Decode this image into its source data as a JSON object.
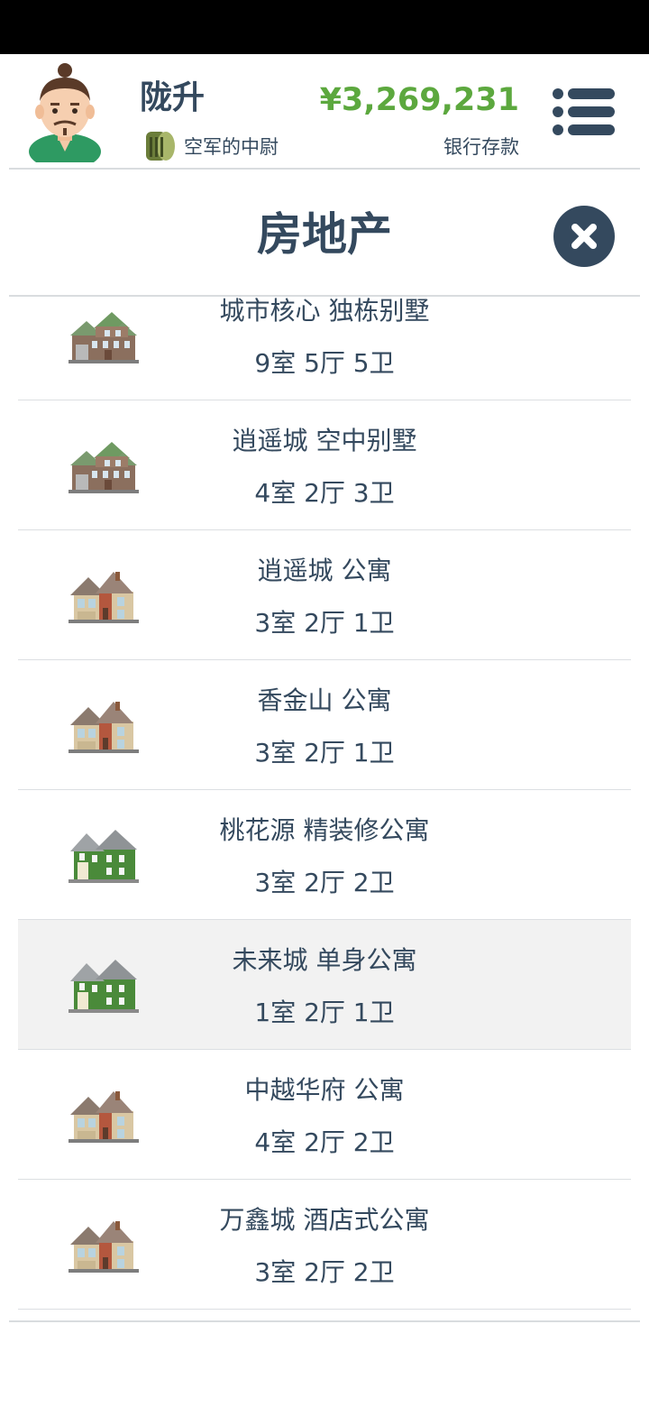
{
  "header": {
    "player_name": "陇升",
    "rank": "空军的中尉",
    "money": "¥3,269,231",
    "money_label": "银行存款",
    "menu_icon": "hamburger-menu-icon",
    "rank_icon": "rank-badge-icon",
    "avatar_icon": "avatar-man-icon"
  },
  "page": {
    "title": "房地产",
    "close_icon": "close-icon"
  },
  "colors": {
    "text": "#34495e",
    "money": "#5ca83e",
    "highlight_row": "#f2f2f2"
  },
  "properties": [
    {
      "name": "城市核心 独栋别墅",
      "rooms": "9室 5厅 5卫",
      "icon": "villa-icon"
    },
    {
      "name": "逍遥城 空中别墅",
      "rooms": "4室 2厅 3卫",
      "icon": "villa-icon"
    },
    {
      "name": "逍遥城 公寓",
      "rooms": "3室 2厅 1卫",
      "icon": "brown-house-icon"
    },
    {
      "name": "香金山 公寓",
      "rooms": "3室 2厅 1卫",
      "icon": "brown-house-icon"
    },
    {
      "name": "桃花源 精装修公寓",
      "rooms": "3室 2厅 2卫",
      "icon": "green-house-icon"
    },
    {
      "name": "未来城 单身公寓",
      "rooms": "1室 2厅 1卫",
      "icon": "green-house-icon",
      "highlighted": true
    },
    {
      "name": "中越华府 公寓",
      "rooms": "4室 2厅 2卫",
      "icon": "brown-house-icon"
    },
    {
      "name": "万鑫城 酒店式公寓",
      "rooms": "3室 2厅 2卫",
      "icon": "brown-house-icon"
    }
  ]
}
